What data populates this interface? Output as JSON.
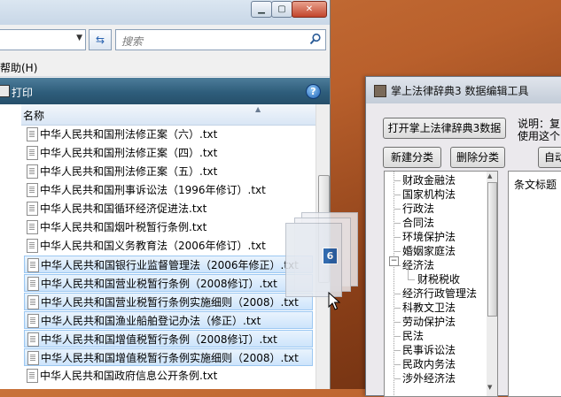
{
  "explorer": {
    "search_placeholder": "搜索",
    "menu_help": "帮助(H)",
    "print_label": "打印",
    "column_name": "名称",
    "files": [
      {
        "name": "中华人民共和国刑法修正案（六）.txt",
        "selected": false
      },
      {
        "name": "中华人民共和国刑法修正案（四）.txt",
        "selected": false
      },
      {
        "name": "中华人民共和国刑法修正案（五）.txt",
        "selected": false
      },
      {
        "name": "中华人民共和国刑事诉讼法（1996年修订）.txt",
        "selected": false
      },
      {
        "name": "中华人民共和国循环经济促进法.txt",
        "selected": false
      },
      {
        "name": "中华人民共和国烟叶税暂行条例.txt",
        "selected": false
      },
      {
        "name": "中华人民共和国义务教育法（2006年修订）.txt",
        "selected": false
      },
      {
        "name": "中华人民共和国银行业监督管理法（2006年修正）.txt",
        "selected": true
      },
      {
        "name": "中华人民共和国营业税暂行条例（2008修订）.txt",
        "selected": true
      },
      {
        "name": "中华人民共和国营业税暂行条例实施细则（2008）.txt",
        "selected": true
      },
      {
        "name": "中华人民共和国渔业船舶登记办法（修正）.txt",
        "selected": true
      },
      {
        "name": "中华人民共和国增值税暂行条例（2008修订）.txt",
        "selected": true
      },
      {
        "name": "中华人民共和国增值税暂行条例实施细则（2008）.txt",
        "selected": true
      },
      {
        "name": "中华人民共和国政府信息公开条例.txt",
        "selected": false
      }
    ]
  },
  "drag": {
    "count": "6"
  },
  "tool": {
    "title": "掌上法律辞典3 数据编辑工具",
    "open_button": "打开掌上法律辞典3数据",
    "note_line1": "说明：复",
    "note_line2": "使用这个",
    "new_category": "新建分类",
    "delete_category": "删除分类",
    "auto_button": "自动",
    "article_title_header": "条文标题",
    "categories": [
      {
        "label": "财政金融法",
        "level": 0
      },
      {
        "label": "国家机构法",
        "level": 0
      },
      {
        "label": "行政法",
        "level": 0
      },
      {
        "label": "合同法",
        "level": 0
      },
      {
        "label": "环境保护法",
        "level": 0
      },
      {
        "label": "婚姻家庭法",
        "level": 0
      },
      {
        "label": "经济法",
        "level": 0,
        "expanded": true
      },
      {
        "label": "财税税收",
        "level": 1
      },
      {
        "label": "经济行政管理法",
        "level": 0
      },
      {
        "label": "科教文卫法",
        "level": 0
      },
      {
        "label": "劳动保护法",
        "level": 0
      },
      {
        "label": "民法",
        "level": 0
      },
      {
        "label": "民事诉讼法",
        "level": 0
      },
      {
        "label": "民政内务法",
        "level": 0
      },
      {
        "label": "涉外经济法",
        "level": 0
      }
    ]
  }
}
